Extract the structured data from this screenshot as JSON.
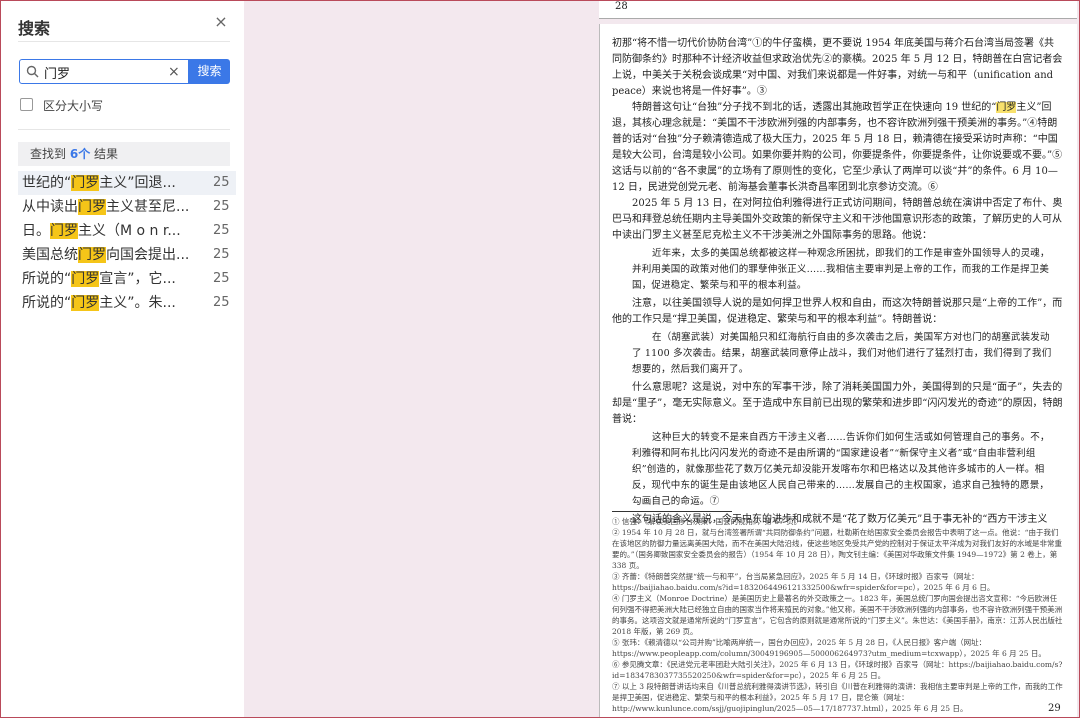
{
  "sidebar": {
    "title": "搜索",
    "close_glyph": "×",
    "search": {
      "value": "门罗",
      "placeholder": "",
      "clear_glyph": "×",
      "button_label": "搜索"
    },
    "case_sensitive_label": "区分大小写",
    "summary_prefix": "查找到",
    "summary_count": "6个",
    "summary_suffix": "结果",
    "results": [
      {
        "pre": "世纪的“",
        "hit": "门罗",
        "post": "主义”回退...",
        "page": "25"
      },
      {
        "pre": "从中读出",
        "hit": "门罗",
        "post": "主义甚至尼...",
        "page": "25"
      },
      {
        "pre": "日。",
        "hit": "门罗",
        "post": "主义（M o n r...",
        "page": "25"
      },
      {
        "pre": "美国总统",
        "hit": "门罗",
        "post": "向国会提出...",
        "page": "25"
      },
      {
        "pre": "所说的“",
        "hit": "门罗",
        "post": "宣言”，它...",
        "page": "25"
      },
      {
        "pre": "所说的“",
        "hit": "门罗",
        "post": "主义”。朱...",
        "page": "25"
      }
    ]
  },
  "document": {
    "top_page_number": "28",
    "bottom_page_number": "29",
    "paragraphs": [
      {
        "type": "p",
        "noindent": true,
        "text": "初那“将不惜一切代价协防台湾”①的牛仔蛮横，更不要说 1954 年底美国与蒋介石台湾当局签署《共同防御条约》时那种不计经济收益但求政治优先②的豪横。2025 年 5 月 12 日，特朗普在白宫记者会上说，中美关于关税会谈成果“对中国、对我们来说都是一件好事，对统一与和平（unification and peace）来说也将是一件好事”。③"
      },
      {
        "type": "p",
        "pre": "特朗普这句让“台独”分子找不到北的话，透露出其施政哲学正在快速向 19 世纪的“",
        "hit": "门罗",
        "post": "主义”回退，其核心理念就是：“美国不干涉欧洲列强的内部事务，也不容许欧洲列强干预美洲的事务。”④特朗普的话对“台独”分子赖清德造成了极大压力，2025 年 5 月 18 日，赖清德在接受采访时声称：“中国是较大公司，台湾是较小公司。如果你要并购的公司，你要提条件，你要提条件，让你说要或不要。”⑤这话与以前的“各不隶属”的立场有了原则性的变化，它至少承认了两岸可以谈“并”的条件。6 月 10—12 日，民进党创党元老、前海基会董事长洪奇昌率团到北京参访交流。⑥"
      },
      {
        "type": "p",
        "text": "2025 年 5 月 13 日，在对阿拉伯利雅得进行正式访问期间，特朗普总统在演讲中否定了布什、奥巴马和拜登总统任期内主导美国外交政策的新保守主义和干涉他国意识形态的政策，了解历史的人可从中读出门罗主义甚至尼克松主义不干涉美洲之外国际事务的思路。他说："
      },
      {
        "type": "quote",
        "text": "近年来，太多的美国总统都被这样一种观念所困扰，即我们的工作是审查外国领导人的灵魂，并利用美国的政策对他们的罪孽伸张正义……我相信主要审判是上帝的工作，而我的工作是捍卫美国，促进稳定、繁荣与和平的根本利益。"
      },
      {
        "type": "p",
        "text": "注意，以往美国领导人说的是如何捍卫世界人权和自由，而这次特朗普说那只是“上帝的工作”，而他的工作只是“捍卫美国，促进稳定、繁荣与和平的根本利益”。特朗普说："
      },
      {
        "type": "quote",
        "text": "在（胡塞武装）对美国船只和红海航行自由的多次袭击之后，美国军方对也门的胡塞武装发动了 1100 多次袭击。结果，胡塞武装同意停止战斗，我们对他们进行了猛烈打击，我们得到了我们想要的，然后我们离开了。"
      },
      {
        "type": "p",
        "text": "什么意思呢？这是说，对中东的军事干涉，除了消耗美国国力外，美国得到的只是“面子”，失去的却是“里子”，毫无实际意义。至于造成中东目前已出现的繁荣和进步即“闪闪发光的奇迹”的原因，特朗普说："
      },
      {
        "type": "quote",
        "text": "这种巨大的转变不是来自西方干涉主义者……告诉你们如何生活或如何管理自己的事务。不，利雅得和阿布扎比闪闪发光的奇迹不是由所谓的“国家建设者”“新保守主义者”或“自由非营利组织”创造的，就像那些花了数万亿美元却没能开发喀布尔和巴格达以及其他许多城市的人一样。相反，现代中东的诞生是由该地区人民自己带来的……发展自己的主权国家，追求自己独特的愿景，勾画自己的命运。⑦"
      },
      {
        "type": "p",
        "text": "这句话的含义是说，今天中东的进步和成就不是“花了数万亿美元”且于事无补的“西方干涉主义"
      }
    ],
    "footnotes": [
      "① 信强：《解读美国涉台决策：国会的视角》，第 67 页。",
      "② 1954 年 10 月 28 日，就与台湾签署所谓“共同防御条约”问题，杜勒斯在给国家安全委员会报告中表明了这一点。他说：“由于我们在该地区的防御力量远离美国大陆，而不在美国大陆沿线，使这些地区免受共产党的控制对于保证太平洋成为对我们友好的水域是非常重要的。”（国务卿致国家安全委员会的报告）（1954 年 10 月 28 日），陶文钊主编：《美国对华政策文件集 1949—1972》第 2 卷上，第 338 页。",
      "③ 齐蕾：《特朗普突然提“统一与和平”，台当局紧急回应》，2025 年 5 月 14 日，《环球时报》百家号（网址：https://baijiahao.baidu.com/s?id=1832064496121332500&wfr=spider&for=pc），2025 年 6 月 6 日。",
      "④ 门罗主义（Monroe Doctrine）是美国历史上最著名的外交政策之一。1823 年，美国总统门罗向国会提出咨文宣称：“今后欧洲任何列强不得把美洲大陆已经独立自由的国家当作将来殖民的对象。”他又称，美国不干涉欧洲列强的内部事务，也不容许欧洲列强干预美洲的事务。这项咨文就是通常所说的“门罗宣言”，它包含的原则就是通常所说的“门罗主义”。朱世达：《美国手册》，南京：江苏人民出版社 2018 年版，第 269 页。",
      "⑤ 张玮：《赖清德以“公司并购”比喻两岸统一，国台办回应》，2025 年 5 月 28 日，《人民日报》客户端（网址：https://www.peopleapp.com/column/30049196905—500006264973?utm_medium=tcxwapp），2025 年 6 月 25 日。",
      "⑥ 参见腾文章：《民进党元老率团赴大陆引关注》，2025 年 6 月 13 日，《环球时报》百家号（网址：https://baijiahao.baidu.com/s?id=1834783037735520250&wfr=spider&for=pc），2025 年 6 月 25 日。",
      "⑦ 以上 3 段特朗普讲话均来自《川普总统利雅得演讲节选》，转引自《川普在利雅得的演讲：我相信主要审判是上帝的工作，而我的工作是捍卫美国，促进稳定、繁荣与和平的根本利益》，2025 年 5 月 17 日，昆仑策（网址：http://www.kunlunce.com/ssjj/guojipinglun/2025—05—17/187737.html），2025 年 6 月 25 日。"
    ]
  }
}
